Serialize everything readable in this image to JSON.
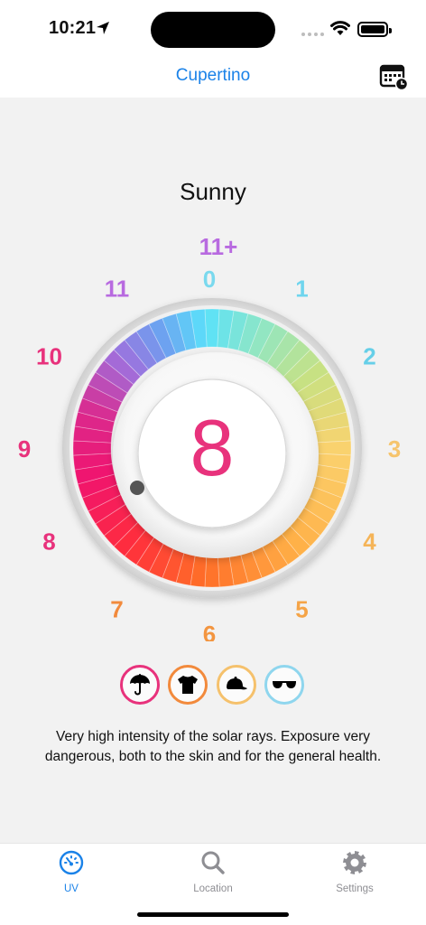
{
  "status": {
    "time": "10:21"
  },
  "nav": {
    "title": "Cupertino"
  },
  "condition": "Sunny",
  "dial": {
    "current_index": "8",
    "labels": [
      {
        "text": "0",
        "color": "#7ad9ee"
      },
      {
        "text": "1",
        "color": "#6fd5ee"
      },
      {
        "text": "2",
        "color": "#66cfe8"
      },
      {
        "text": "3",
        "color": "#f6c46c"
      },
      {
        "text": "4",
        "color": "#f5b458"
      },
      {
        "text": "5",
        "color": "#f5a447"
      },
      {
        "text": "6",
        "color": "#f39540"
      },
      {
        "text": "7",
        "color": "#f28a3c"
      },
      {
        "text": "8",
        "color": "#e8327c"
      },
      {
        "text": "9",
        "color": "#e8327c"
      },
      {
        "text": "10",
        "color": "#e8327c"
      },
      {
        "text": "11",
        "color": "#b86ae0"
      },
      {
        "text": "11+",
        "color": "#b86ae0"
      }
    ]
  },
  "advice": [
    {
      "name": "umbrella-icon",
      "ring": "#e8327c"
    },
    {
      "name": "tshirt-icon",
      "ring": "#f28a3c"
    },
    {
      "name": "cap-icon",
      "ring": "#f5c16c"
    },
    {
      "name": "sunglasses-icon",
      "ring": "#8fd6ee"
    }
  ],
  "description": "Very high intensity of the solar rays. Exposure very dangerous, both to the skin and for the general health.",
  "tabs": [
    {
      "label": "UV",
      "active": true
    },
    {
      "label": "Location",
      "active": false
    },
    {
      "label": "Settings",
      "active": false
    }
  ],
  "colors": {
    "accent": "#1a82e8",
    "inactive": "#8e8e93",
    "value": "#e8327c"
  }
}
